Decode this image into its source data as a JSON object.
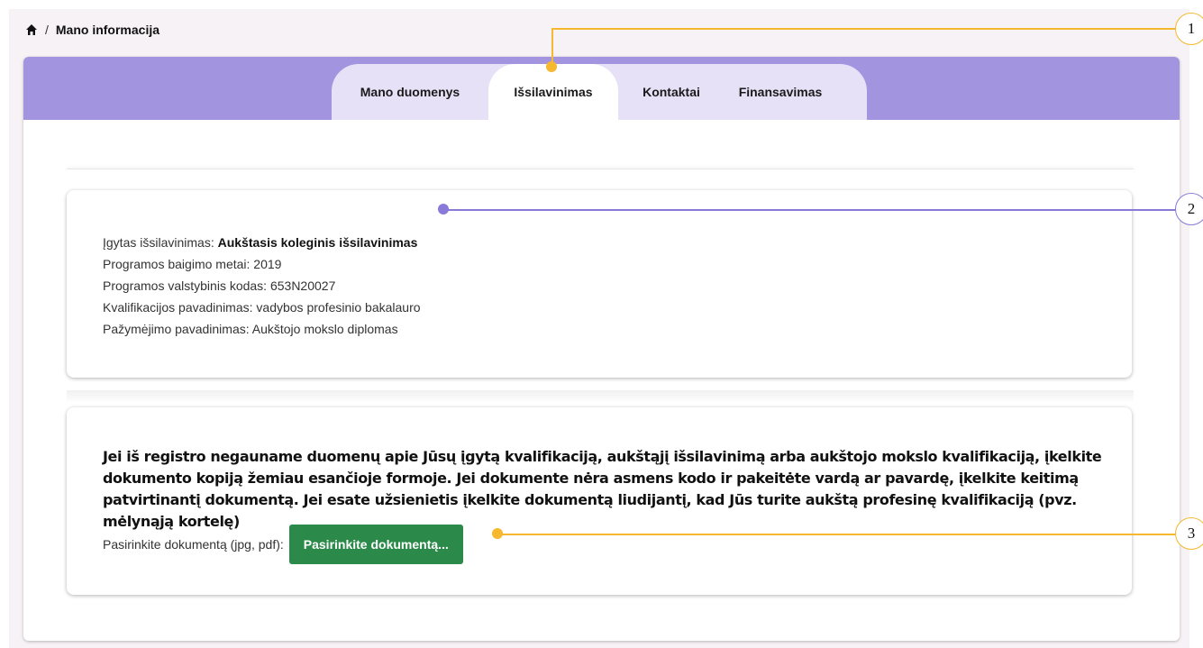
{
  "breadcrumb": {
    "separator": "/",
    "current": "Mano informacija"
  },
  "tabs": [
    {
      "label": "Mano duomenys",
      "active": false
    },
    {
      "label": "Išsilavinimas",
      "active": true
    },
    {
      "label": "Kontaktai",
      "active": false
    },
    {
      "label": "Finansavimas",
      "active": false
    }
  ],
  "education": {
    "acquired_label": "Įgytas išsilavinimas: ",
    "acquired_value": "Aukštasis koleginis išsilavinimas",
    "line_graduation": "Programos baigimo metai: 2019",
    "line_code": "Programos valstybinis kodas: 653N20027",
    "line_qualification": "Kvalifikacijos pavadinimas: vadybos profesinio bakalauro",
    "line_certificate": "Pažymėjimo pavadinimas: Aukštojo mokslo diplomas"
  },
  "upload": {
    "notice": "Jei iš registro negauname duomenų apie Jūsų įgytą kvalifikaciją, aukštąjį išsilavinimą arba aukštojo mokslo kvalifikaciją, įkelkite dokumento kopiją žemiau esančioje formoje. Jei dokumente nėra asmens kodo ir pakeitėte vardą ar pavardę, įkelkite keitimą patvirtinantį dokumentą. Jei esate užsienietis įkelkite dokumentą liudijantį, kad Jūs turite aukštą profesinę kvalifikaciją (pvz. mėlynąją kortelę)",
    "file_label": "Pasirinkite dokumentą (jpg, pdf):",
    "button_label": "Pasirinkite dokumentą..."
  },
  "callouts": [
    "1",
    "2",
    "3"
  ],
  "colors": {
    "tabs_band": "#a394e0",
    "tabs_pill": "#e6e1f7",
    "button_green": "#2b8a4a",
    "callout_orange": "#f5b82e",
    "callout_purple": "#8a7ad8"
  },
  "icons": {
    "breadcrumb_home": "home-icon"
  }
}
